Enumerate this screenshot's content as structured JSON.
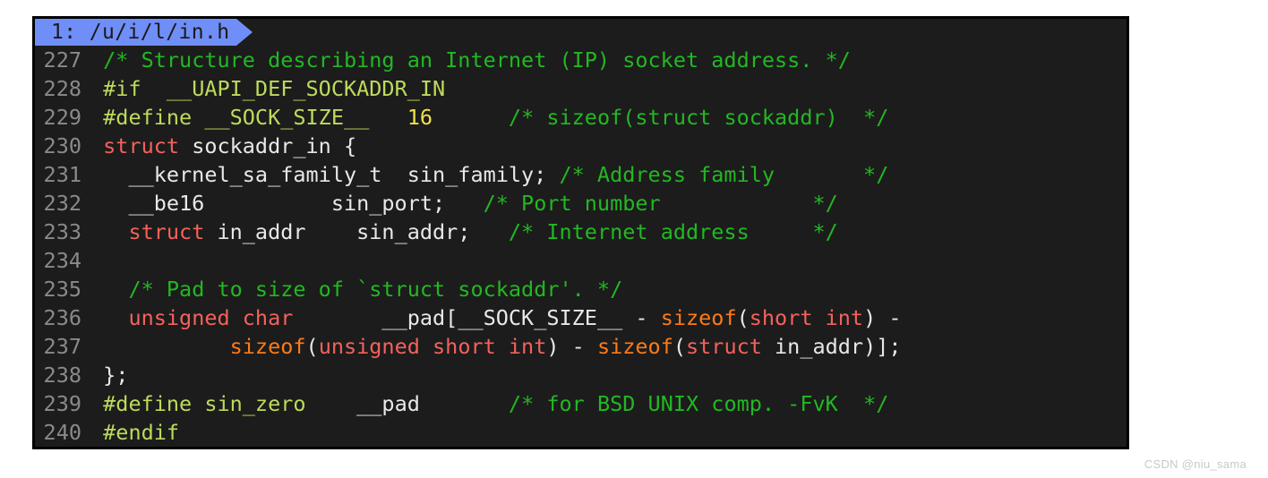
{
  "colors": {
    "page_background": "#ffffff",
    "terminal_background": "#1c1c1c",
    "terminal_border": "#000000",
    "tab_active_background": "#6f8ef7",
    "tab_active_text": "#1a1a1a",
    "line_number": "#8a8a8a",
    "comment": "#22b822",
    "preprocessor": "#bddb5c",
    "type_keyword": "#f5615c",
    "plain_text": "#e8e8e8",
    "number_literal": "#f2e14c",
    "function_name": "#ff7a18",
    "watermark": "#c9c9c9"
  },
  "tabline": {
    "tabs": [
      {
        "label": "1: /u/i/l/in.h",
        "active": true
      }
    ]
  },
  "editor": {
    "first_line_number": 227,
    "lines": [
      {
        "number": "227",
        "spans": [
          {
            "text": " ",
            "kind": "plain"
          },
          {
            "text": "/* Structure describing an Internet (IP) socket address. */",
            "kind": "comment"
          }
        ]
      },
      {
        "number": "228",
        "spans": [
          {
            "text": " ",
            "kind": "plain"
          },
          {
            "text": "#if  __UAPI_DEF_SOCKADDR_IN",
            "kind": "preproc"
          }
        ]
      },
      {
        "number": "229",
        "spans": [
          {
            "text": " ",
            "kind": "plain"
          },
          {
            "text": "#define __SOCK_SIZE__",
            "kind": "preproc"
          },
          {
            "text": "   ",
            "kind": "plain"
          },
          {
            "text": "16",
            "kind": "number"
          },
          {
            "text": "      ",
            "kind": "plain"
          },
          {
            "text": "/* sizeof(struct sockaddr)  */",
            "kind": "comment"
          }
        ]
      },
      {
        "number": "230",
        "spans": [
          {
            "text": " ",
            "kind": "plain"
          },
          {
            "text": "struct",
            "kind": "type"
          },
          {
            "text": " sockaddr_in {",
            "kind": "plain"
          }
        ]
      },
      {
        "number": "231",
        "spans": [
          {
            "text": "   __kernel_sa_family_t  sin_family;",
            "kind": "plain"
          },
          {
            "text": " /* Address family       */",
            "kind": "comment"
          }
        ]
      },
      {
        "number": "232",
        "spans": [
          {
            "text": "   __be16          sin_port;",
            "kind": "plain"
          },
          {
            "text": "   /* Port number            */",
            "kind": "comment"
          }
        ]
      },
      {
        "number": "233",
        "spans": [
          {
            "text": "   ",
            "kind": "plain"
          },
          {
            "text": "struct",
            "kind": "type"
          },
          {
            "text": " in_addr    sin_addr;",
            "kind": "plain"
          },
          {
            "text": "   /* Internet address     */",
            "kind": "comment"
          }
        ]
      },
      {
        "number": "234",
        "spans": [
          {
            "text": "",
            "kind": "plain"
          }
        ]
      },
      {
        "number": "235",
        "spans": [
          {
            "text": "   ",
            "kind": "plain"
          },
          {
            "text": "/* Pad to size of `struct sockaddr'. */",
            "kind": "comment"
          }
        ]
      },
      {
        "number": "236",
        "spans": [
          {
            "text": "   ",
            "kind": "plain"
          },
          {
            "text": "unsigned char",
            "kind": "type"
          },
          {
            "text": "       __pad[__SOCK_SIZE__ - ",
            "kind": "plain"
          },
          {
            "text": "sizeof",
            "kind": "func"
          },
          {
            "text": "(",
            "kind": "plain"
          },
          {
            "text": "short int",
            "kind": "type"
          },
          {
            "text": ") -",
            "kind": "plain"
          }
        ]
      },
      {
        "number": "237",
        "spans": [
          {
            "text": "           ",
            "kind": "plain"
          },
          {
            "text": "sizeof",
            "kind": "func"
          },
          {
            "text": "(",
            "kind": "plain"
          },
          {
            "text": "unsigned short int",
            "kind": "type"
          },
          {
            "text": ") - ",
            "kind": "plain"
          },
          {
            "text": "sizeof",
            "kind": "func"
          },
          {
            "text": "(",
            "kind": "plain"
          },
          {
            "text": "struct",
            "kind": "type"
          },
          {
            "text": " in_addr)];",
            "kind": "plain"
          }
        ]
      },
      {
        "number": "238",
        "spans": [
          {
            "text": " };",
            "kind": "plain"
          }
        ]
      },
      {
        "number": "239",
        "spans": [
          {
            "text": " ",
            "kind": "plain"
          },
          {
            "text": "#define sin_zero",
            "kind": "preproc"
          },
          {
            "text": "    __pad",
            "kind": "plain"
          },
          {
            "text": "       ",
            "kind": "plain"
          },
          {
            "text": "/* for BSD UNIX comp. -FvK  */",
            "kind": "comment"
          }
        ]
      },
      {
        "number": "240",
        "spans": [
          {
            "text": " ",
            "kind": "plain"
          },
          {
            "text": "#endif",
            "kind": "preproc"
          }
        ]
      }
    ]
  },
  "watermark": {
    "text": "CSDN @niu_sama"
  }
}
